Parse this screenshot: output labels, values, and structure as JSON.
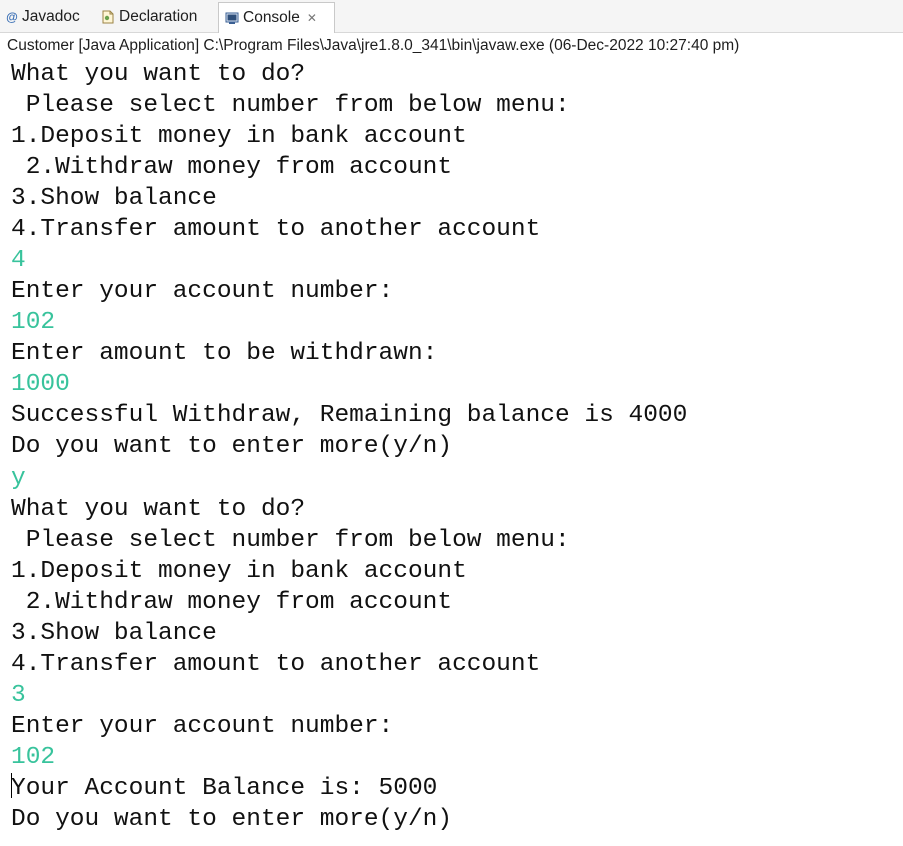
{
  "tabs": [
    {
      "icon": "at-sign-icon",
      "label": "Javadoc"
    },
    {
      "icon": "declaration-icon",
      "label": "Declaration"
    },
    {
      "icon": "console-icon",
      "label": "Console",
      "close": "✕"
    }
  ],
  "console_header": "Customer [Java Application] C:\\Program Files\\Java\\jre1.8.0_341\\bin\\javaw.exe (06-Dec-2022 10:27:40 pm)",
  "console_lines": [
    {
      "text": "What you want to do?",
      "kind": "output"
    },
    {
      "text": " Please select number from below menu:",
      "kind": "output"
    },
    {
      "text": "1.Deposit money in bank account",
      "kind": "output"
    },
    {
      "text": " 2.Withdraw money from account",
      "kind": "output"
    },
    {
      "text": "3.Show balance",
      "kind": "output"
    },
    {
      "text": "4.Transfer amount to another account",
      "kind": "output"
    },
    {
      "text": "4",
      "kind": "input"
    },
    {
      "text": "Enter your account number:",
      "kind": "output"
    },
    {
      "text": "102",
      "kind": "input"
    },
    {
      "text": "Enter amount to be withdrawn:",
      "kind": "output"
    },
    {
      "text": "1000",
      "kind": "input"
    },
    {
      "text": "Successful Withdraw, Remaining balance is 4000",
      "kind": "output"
    },
    {
      "text": "Do you want to enter more(y/n)",
      "kind": "output"
    },
    {
      "text": "y",
      "kind": "input"
    },
    {
      "text": "What you want to do?",
      "kind": "output"
    },
    {
      "text": " Please select number from below menu:",
      "kind": "output"
    },
    {
      "text": "1.Deposit money in bank account",
      "kind": "output"
    },
    {
      "text": " 2.Withdraw money from account",
      "kind": "output"
    },
    {
      "text": "3.Show balance",
      "kind": "output"
    },
    {
      "text": "4.Transfer amount to another account",
      "kind": "output"
    },
    {
      "text": "3",
      "kind": "input"
    },
    {
      "text": "Enter your account number:",
      "kind": "output"
    },
    {
      "text": "102",
      "kind": "input"
    },
    {
      "text": "Your Account Balance is: 5000",
      "kind": "output"
    },
    {
      "text": "Do you want to enter more(y/n)",
      "kind": "output"
    }
  ],
  "colors": {
    "input_text": "#38c39c",
    "output_text": "#111111"
  }
}
